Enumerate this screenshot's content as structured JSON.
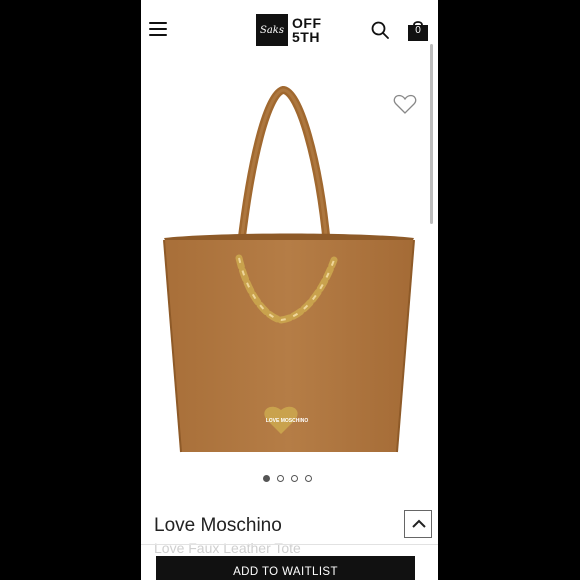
{
  "header": {
    "logo_mark": "Saks",
    "logo_line1": "OFF",
    "logo_line2": "5TH",
    "cart_count": "0"
  },
  "icons": {
    "menu": "hamburger-menu-icon",
    "search": "search-icon",
    "bag": "shopping-bag-icon",
    "wishlist": "heart-icon",
    "scroll_top": "chevron-up-icon"
  },
  "product": {
    "brand": "Love Moschino",
    "subtitle": "Love Faux Leather Tote",
    "image_count": 4,
    "active_image": 1,
    "plaque_text": "LOVE MOSCHINO"
  },
  "actions": {
    "waitlist_label": "ADD TO WAITLIST"
  },
  "colors": {
    "bag": "#b07a43",
    "accent": "#111111",
    "hardware": "#c9a24d"
  }
}
